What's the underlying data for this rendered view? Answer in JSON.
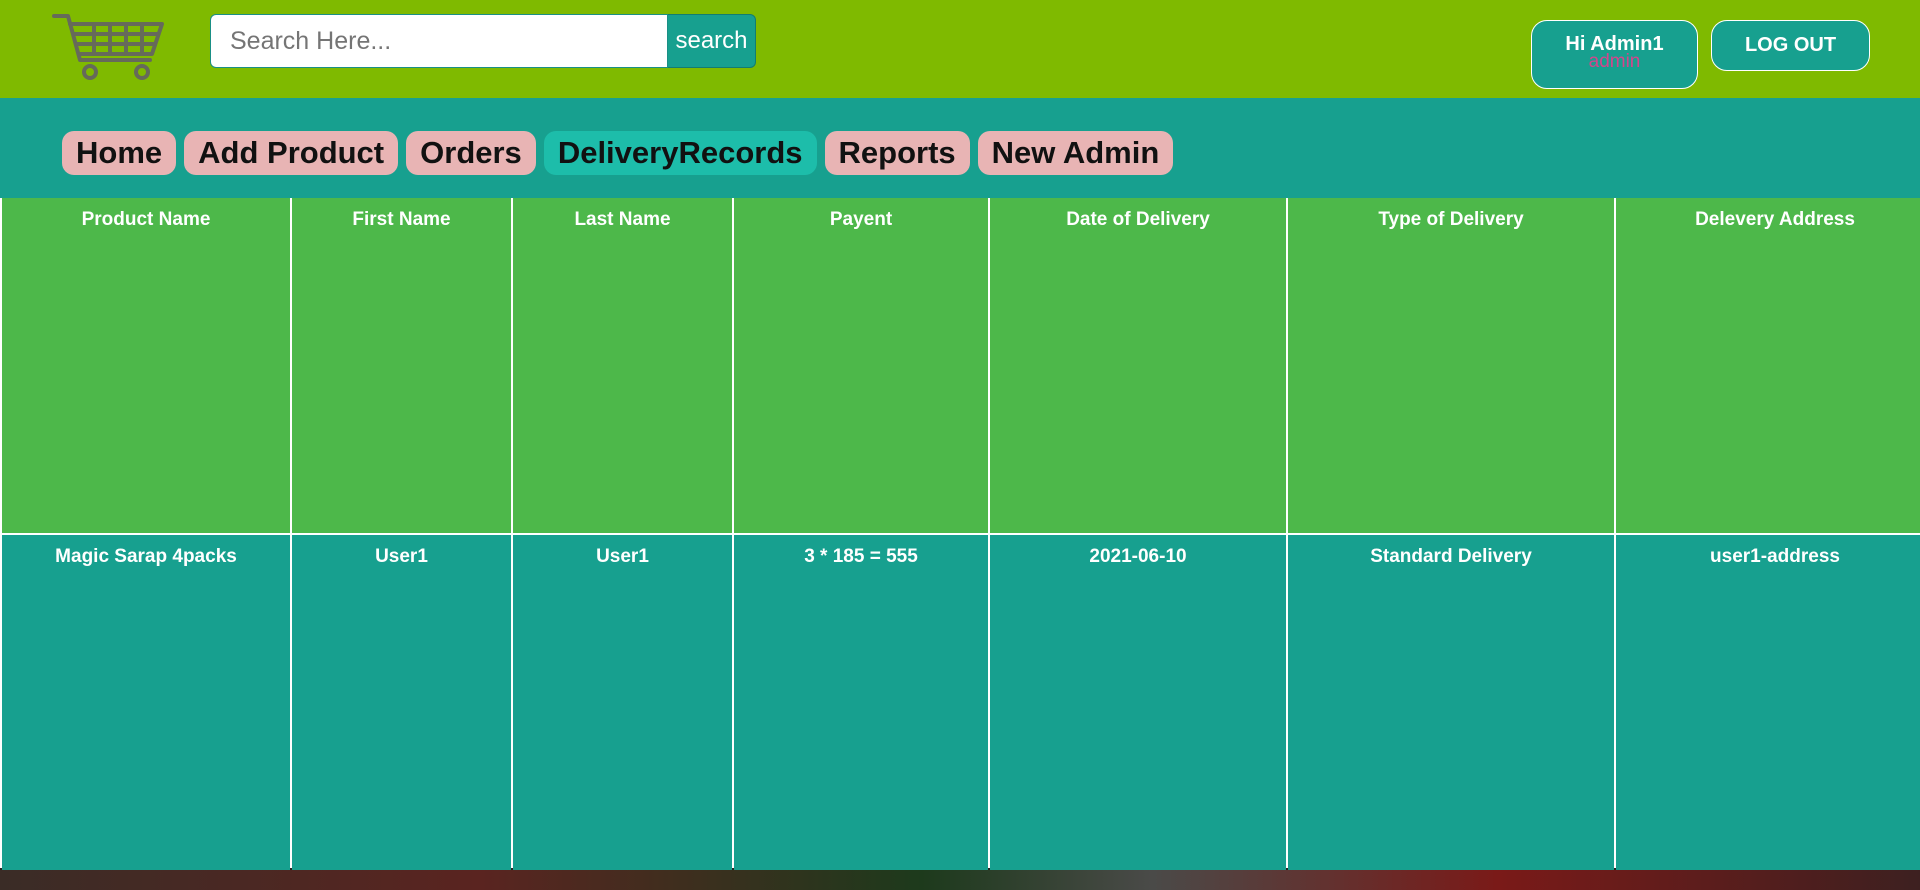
{
  "header": {
    "search": {
      "placeholder": "Search Here...",
      "value": "",
      "button_label": "search"
    },
    "user": {
      "greeting": "Hi Admin1",
      "role": "admin"
    },
    "logout_label": "LOG OUT"
  },
  "nav": {
    "items": [
      {
        "label": "Home",
        "active": false
      },
      {
        "label": "Add Product",
        "active": false
      },
      {
        "label": "Orders",
        "active": false
      },
      {
        "label": "DeliveryRecords",
        "active": true
      },
      {
        "label": "Reports",
        "active": false
      },
      {
        "label": "New Admin",
        "active": false
      }
    ]
  },
  "table": {
    "columns": [
      "Product Name",
      "First Name",
      "Last Name",
      "Payent",
      "Date of Delivery",
      "Type of Delivery",
      "Delevery Address"
    ],
    "rows": [
      [
        "Magic Sarap 4packs",
        "User1",
        "User1",
        "3 * 185 = 555",
        "2021-06-10",
        "Standard Delivery",
        "user1-address"
      ]
    ]
  },
  "colors": {
    "header_bg": "#7fba00",
    "teal": "#17a08f",
    "header_cell": "#4db84a",
    "tab_bg": "#e8b4b4",
    "tab_active": "#1dbdaa",
    "role_text": "#d4458c"
  },
  "icons": {
    "logo": "shopping-cart-icon"
  }
}
